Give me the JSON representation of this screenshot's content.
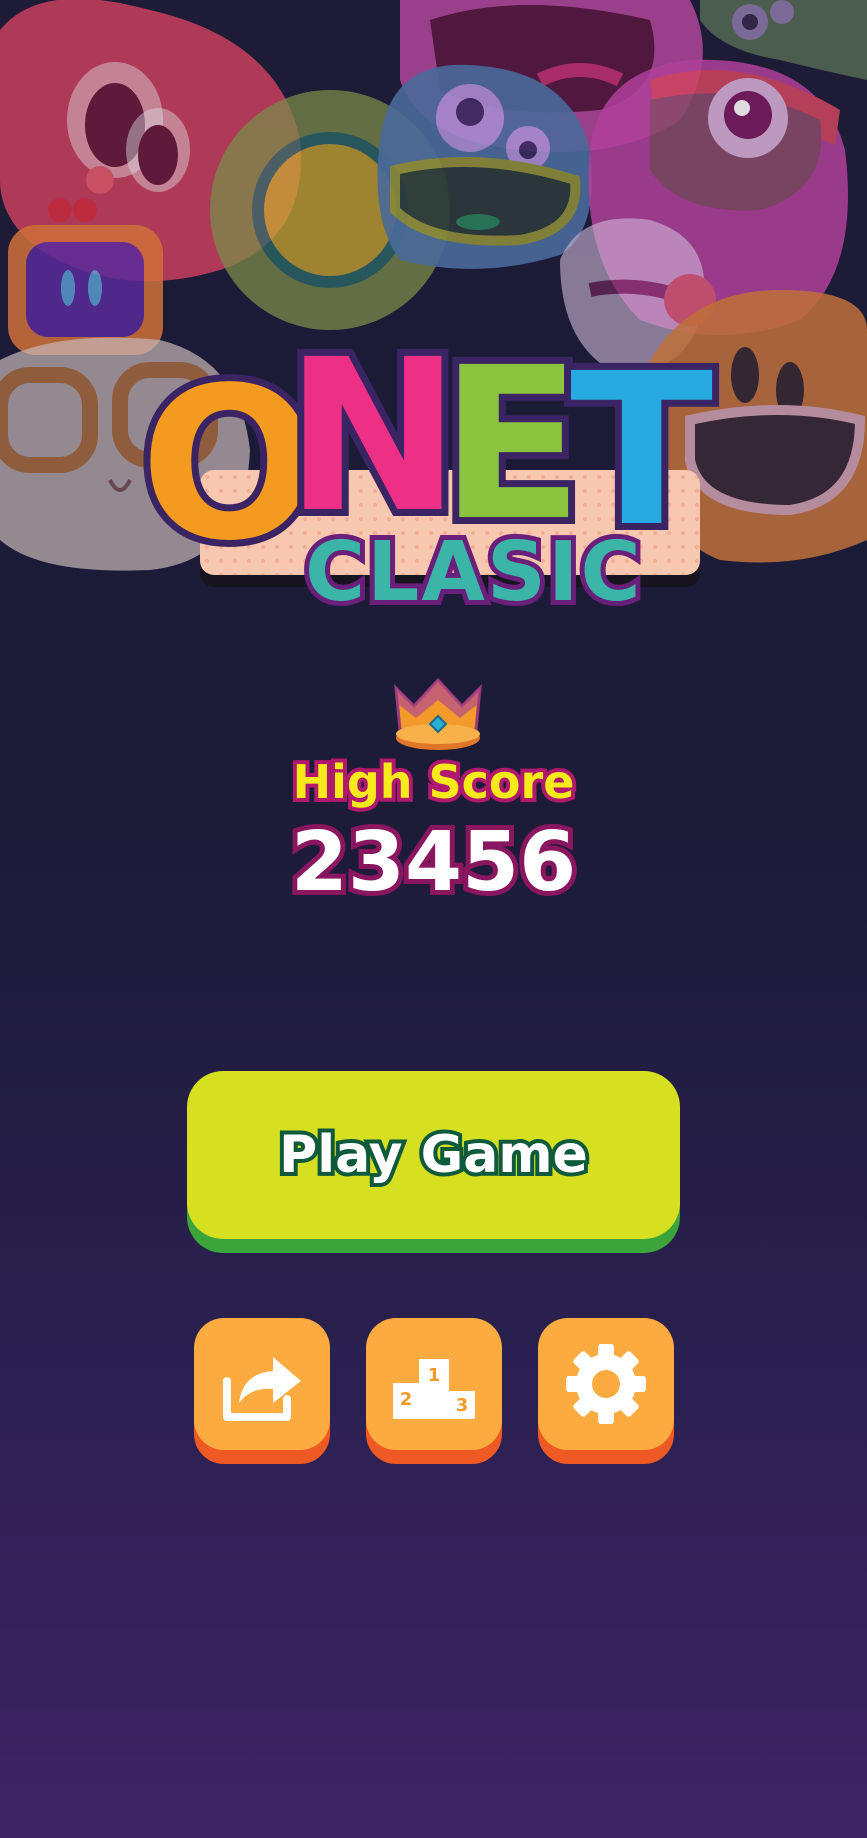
{
  "logo": {
    "letters": [
      "O",
      "N",
      "E",
      "T"
    ],
    "subtitle": "CLASIC"
  },
  "high_score": {
    "label": "High Score",
    "value": "23456"
  },
  "play_button": {
    "label": "Play Game"
  },
  "icon_buttons": [
    {
      "icon": "share-icon"
    },
    {
      "icon": "podium-icon",
      "ranks": [
        "1",
        "2",
        "3"
      ]
    },
    {
      "icon": "gear-icon"
    }
  ],
  "colors": {
    "play_button": "#d6e021",
    "icon_button": "#fbab3f",
    "high_score_label": "#f6ea1a",
    "background_top": "#1d1b36",
    "background_bottom": "#3f2465"
  }
}
